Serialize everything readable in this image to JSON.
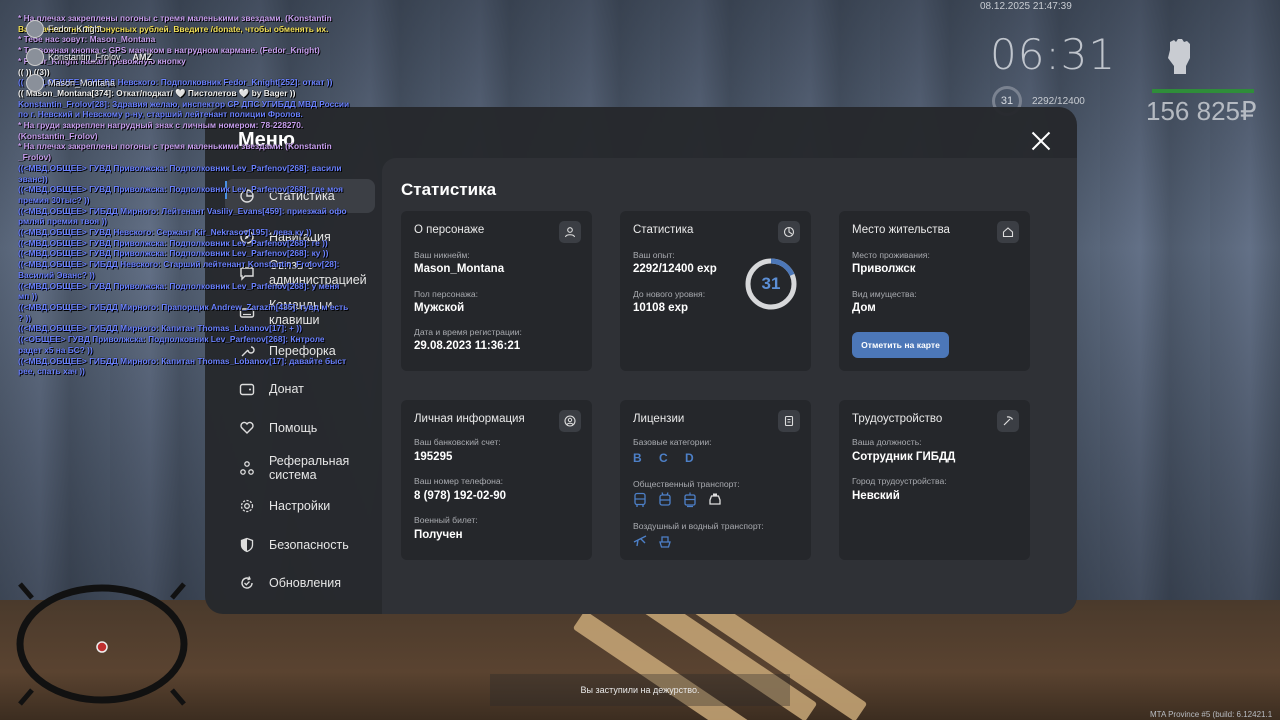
{
  "hud": {
    "datetime": "08.12.2025 21:47:39",
    "clock": "06:31",
    "level": "31",
    "exp": "2292/12400",
    "money": "156 825₽",
    "build": "MTA Province #5 (build: 6.12421.1"
  },
  "players": [
    {
      "name": "Fedor_Knight",
      "tag": ""
    },
    {
      "name": "Konstantin_Frolov",
      "tag": "AMZ"
    },
    {
      "name": "Mason_Montana",
      "tag": ""
    }
  ],
  "chat": [
    {
      "c": "c-p",
      "t": "* На плечах закреплены погоны с тремя маленькими звездами. (Konstantin"
    },
    {
      "c": "c-y",
      "t": "Вам начислено 30 бонусных рублей. Введите /donate, чтобы обменять их."
    },
    {
      "c": "c-p",
      "t": "* Тебе нас зовут: Mason_Montana"
    },
    {
      "c": "c-p",
      "t": "* Тревожная кнопка с GPS маячком в нагрудном кармане. (Fedor_Knight)"
    },
    {
      "c": "c-p",
      "t": "* Fedor_Knight нажал тревожную кнопку"
    },
    {
      "c": "c-w",
      "t": "(( )) ((3))"
    },
    {
      "c": "c-b",
      "t": "(( МВД.ОБЩЕЕ> ГИБДД Невского: Подполковник Fedor_Knight[252]: откат ))"
    },
    {
      "c": "c-w",
      "t": "(( Mason_Montana[374]: Откат/подкат/ 🤍 Пистолетов 🤍 by Bager ))"
    },
    {
      "c": "c-b",
      "t": "Konstantin_Frolov[28]: Здравия желаю, инспектор СР ДПС УГИБДД МВД России"
    },
    {
      "c": "c-b",
      "t": " по г. Невский и Невскому р-ну, старший лейтенант полиции Фролов."
    },
    {
      "c": "c-p",
      "t": "* На груди закреплен нагрудный знак с личным номером: 78-228270."
    },
    {
      "c": "c-p",
      "t": "(Konstantin_Frolov)"
    },
    {
      "c": "c-p",
      "t": "* На плечах закреплены погоны с тремя маленькими звездами. (Konstantin"
    },
    {
      "c": "c-p",
      "t": " _Frolov)"
    },
    {
      "c": "c-b",
      "t": "((<МВД.ОБЩЕЕ> ГУВД Приволжска: Подполковник Lev_Parfenov[268]: васили"
    },
    {
      "c": "c-b",
      "t": " эванс))"
    },
    {
      "c": "c-b",
      "t": "((<МВД.ОБЩЕЕ> ГУВД Приволжска: Подполковник Lev_Parfenov[268]: где моя"
    },
    {
      "c": "c-b",
      "t": " премия 30тыс? ))"
    },
    {
      "c": "c-b",
      "t": "((<МВД.ОБЩЕЕ> ГИБДД Мирного: Лейтенант Vasiliy_Evans[459]: приезжай офо"
    },
    {
      "c": "c-b",
      "t": " рмляй премия твоя ))"
    },
    {
      "c": "c-b",
      "t": "((<МВД.ОБЩЕЕ> ГУВД Невского: Сержант Kir_Nekrasov[195]: лева ку ))"
    },
    {
      "c": "c-b",
      "t": "((<МВД.ОБЩЕЕ> ГУВД Приволжска: Подполковник Lev_Parfenov[268]: ге ))"
    },
    {
      "c": "c-b",
      "t": "((<МВД.ОБЩЕЕ> ГУВД Приволжска: Подполковник Lev_Parfenov[268]: ку ))"
    },
    {
      "c": "c-b",
      "t": "((<МВД.ОБЩЕЕ> ГИБДД Невского: Старший лейтенант Konstantin_Frolov[28]:"
    },
    {
      "c": "c-b",
      "t": " Василий Эванс? ))"
    },
    {
      "c": "c-b",
      "t": "((<МВД.ОБЩЕЕ> ГУВД Приволжска: Подполковник Lev_Parfenov[268]: у меня"
    },
    {
      "c": "c-b",
      "t": " мп ))"
    },
    {
      "c": "c-b",
      "t": "((<МВД.ОБЩЕЕ> ГИБДД Мирного: Прапорщик Andrew_Zarazin[435]: гувд м есть"
    },
    {
      "c": "c-b",
      "t": " ? ))"
    },
    {
      "c": "c-b",
      "t": "((<МВД.ОБЩЕЕ> ГИБДД Мирного: Капитан Thomas_Lobanov[17]: + ))"
    },
    {
      "c": "c-b",
      "t": "((<ОБЩЕЕ> ГУВД Приволжска: Подполковник Lev_Parfenov[268]: Кнтроле"
    },
    {
      "c": "c-b",
      "t": " радет х5 на БС? ))"
    },
    {
      "c": "c-b",
      "t": "((<МВД.ОБЩЕЕ> ГИБДД Мирного: Капитан Thomas_Lobanov[17]: давайте быст"
    },
    {
      "c": "c-b",
      "t": " рее, спать хач ))"
    }
  ],
  "menu": {
    "title": "Меню",
    "items": [
      {
        "label": "Статистика",
        "icon": "pie-chart-icon",
        "name": "statistics"
      },
      {
        "label": "Навигация",
        "icon": "compass-icon",
        "name": "navigation"
      },
      {
        "label": "Связь с администрацией",
        "icon": "chat-icon",
        "name": "admin-contact"
      },
      {
        "label": "Команды и клавиши",
        "icon": "keyboard-icon",
        "name": "commands"
      },
      {
        "label": "Перефорка",
        "icon": "wrench-icon",
        "name": "misc"
      },
      {
        "label": "Донат",
        "icon": "wallet-icon",
        "name": "donate"
      },
      {
        "label": "Помощь",
        "icon": "heart-hand-icon",
        "name": "help"
      },
      {
        "label": "Реферальная система",
        "icon": "network-icon",
        "name": "referral"
      },
      {
        "label": "Настройки",
        "icon": "gear-icon",
        "name": "settings"
      },
      {
        "label": "Безопасность",
        "icon": "shield-icon",
        "name": "security"
      },
      {
        "label": "Обновления",
        "icon": "update-icon",
        "name": "updates"
      }
    ]
  },
  "stats": {
    "title": "Статистика",
    "character": {
      "title": "О персонаже",
      "nick_label": "Ваш никнейм:",
      "nick": "Mason_Montana",
      "sex_label": "Пол персонажа:",
      "sex": "Мужской",
      "reg_label": "Дата и время регистрации:",
      "reg": "29.08.2023 11:36:21"
    },
    "statistics": {
      "title": "Статистика",
      "exp_label": "Ваш опыт:",
      "exp": "2292/12400 exp",
      "next_label": "До нового уровня:",
      "next": "10108 exp",
      "level": "31",
      "progress": 0.185
    },
    "residence": {
      "title": "Место жительства",
      "place_label": "Место проживания:",
      "place": "Приволжск",
      "property_label": "Вид имущества:",
      "property": "Дом",
      "button": "Отметить на карте"
    },
    "personal": {
      "title": "Личная информация",
      "bank_label": "Ваш банковский счет:",
      "bank": "195295",
      "phone_label": "Ваш номер телефона:",
      "phone": "8 (978) 192-02-90",
      "military_label": "Военный билет:",
      "military": "Получен"
    },
    "licenses": {
      "title": "Лицензии",
      "base_label": "Базовые категории:",
      "base": "B C D",
      "public_label": "Общественный транспорт:",
      "air_label": "Воздушный и водный транспорт:"
    },
    "job": {
      "title": "Трудоустройство",
      "position_label": "Ваша должность:",
      "position": "Сотрудник ГИБДД",
      "city_label": "Город трудоустройства:",
      "city": "Невский"
    }
  },
  "toast": "Вы заступили на дежурство.",
  "colors": {
    "accent": "#4c77b8",
    "panel": "#25272b",
    "ring": "#5c8fd6"
  }
}
